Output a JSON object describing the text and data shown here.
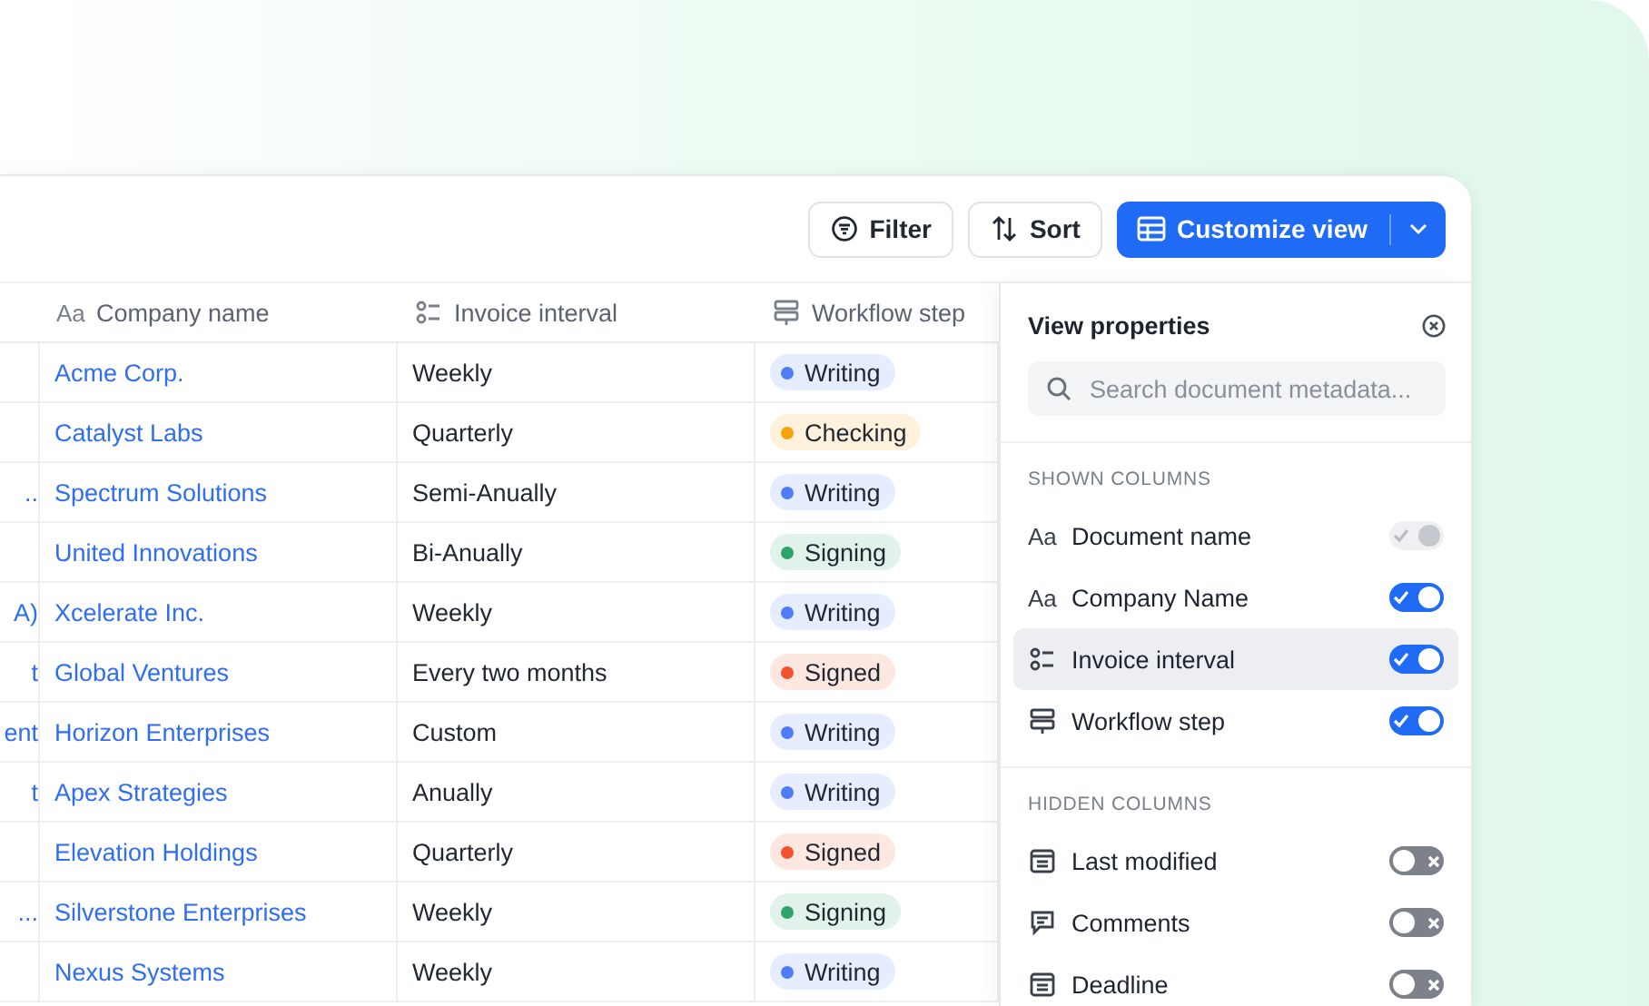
{
  "toolbar": {
    "buttons": [
      {
        "kind": "filter",
        "label": "Filter"
      },
      {
        "kind": "sort",
        "label": "Sort"
      }
    ],
    "primary": {
      "label": "Customize view"
    }
  },
  "table": {
    "columns": [
      {
        "kind": "none"
      },
      {
        "kind": "text",
        "glyph": "Aa",
        "label": "Company name"
      },
      {
        "kind": "list",
        "label": "Invoice interval"
      },
      {
        "kind": "workflow",
        "label": "Workflow step"
      }
    ],
    "rows": [
      {
        "company": "Acme Corp.",
        "interval": "Weekly",
        "step": {
          "label": "Writing",
          "color": "#4f7cf7"
        }
      },
      {
        "company": "Catalyst Labs",
        "interval": "Quarterly",
        "step": {
          "label": "Checking",
          "color": "#f5a30a"
        }
      },
      {
        "column_1": "..",
        "company": "Spectrum Solutions",
        "interval": "Semi-Anually",
        "step": {
          "label": "Writing",
          "color": "#4f7cf7"
        }
      },
      {
        "company": "United Innovations",
        "interval": "Bi-Anually",
        "step": {
          "label": "Signing",
          "color": "#2ea36b"
        }
      },
      {
        "column_1": "A)",
        "company": "Xcelerate Inc.",
        "interval": "Weekly",
        "step": {
          "label": "Writing",
          "color": "#4f7cf7"
        }
      },
      {
        "column_1": "t",
        "company": "Global Ventures",
        "interval": "Every two months",
        "step": {
          "label": "Signed",
          "color": "#f0532d"
        }
      },
      {
        "column_1": "ent",
        "company": "Horizon Enterprises",
        "interval": "Custom",
        "step": {
          "label": "Writing",
          "color": "#4f7cf7"
        }
      },
      {
        "column_1": "t",
        "company": "Apex Strategies",
        "interval": "Anually",
        "step": {
          "label": "Writing",
          "color": "#4f7cf7"
        }
      },
      {
        "company": "Elevation Holdings",
        "interval": "Quarterly",
        "step": {
          "label": "Signed",
          "color": "#f0532d"
        }
      },
      {
        "column_1": "...",
        "company": "Silverstone Enterprises",
        "interval": "Weekly",
        "step": {
          "label": "Signing",
          "color": "#2ea36b"
        }
      },
      {
        "company": "Nexus Systems",
        "interval": "Weekly",
        "step": {
          "label": "Writing",
          "color": "#4f7cf7"
        }
      }
    ]
  },
  "view_properties": {
    "title": "View properties",
    "search": {
      "placeholder": "Search document metadata..."
    },
    "sections": [
      {
        "heading": "SHOWN COLUMNS",
        "items": [
          {
            "kind": "text",
            "glyph": "Aa",
            "label": "Document name",
            "on": true,
            "disabled": true,
            "highlighted": false
          },
          {
            "kind": "text",
            "glyph": "Aa",
            "label": "Company Name",
            "on": true,
            "disabled": false,
            "highlighted": false
          },
          {
            "kind": "list",
            "label": "Invoice interval",
            "on": true,
            "disabled": false,
            "highlighted": true
          },
          {
            "kind": "workflow",
            "label": "Workflow step",
            "on": true,
            "disabled": false,
            "highlighted": false
          }
        ]
      },
      {
        "heading": "HIDDEN COLUMNS",
        "items": [
          {
            "kind": "calendar",
            "label": "Last modified",
            "on": false,
            "disabled": false,
            "highlighted": false
          },
          {
            "kind": "comment",
            "label": "Comments",
            "on": false,
            "disabled": false,
            "highlighted": false
          },
          {
            "kind": "calendar",
            "label": "Deadline",
            "on": false,
            "disabled": false,
            "highlighted": false
          }
        ]
      }
    ]
  }
}
